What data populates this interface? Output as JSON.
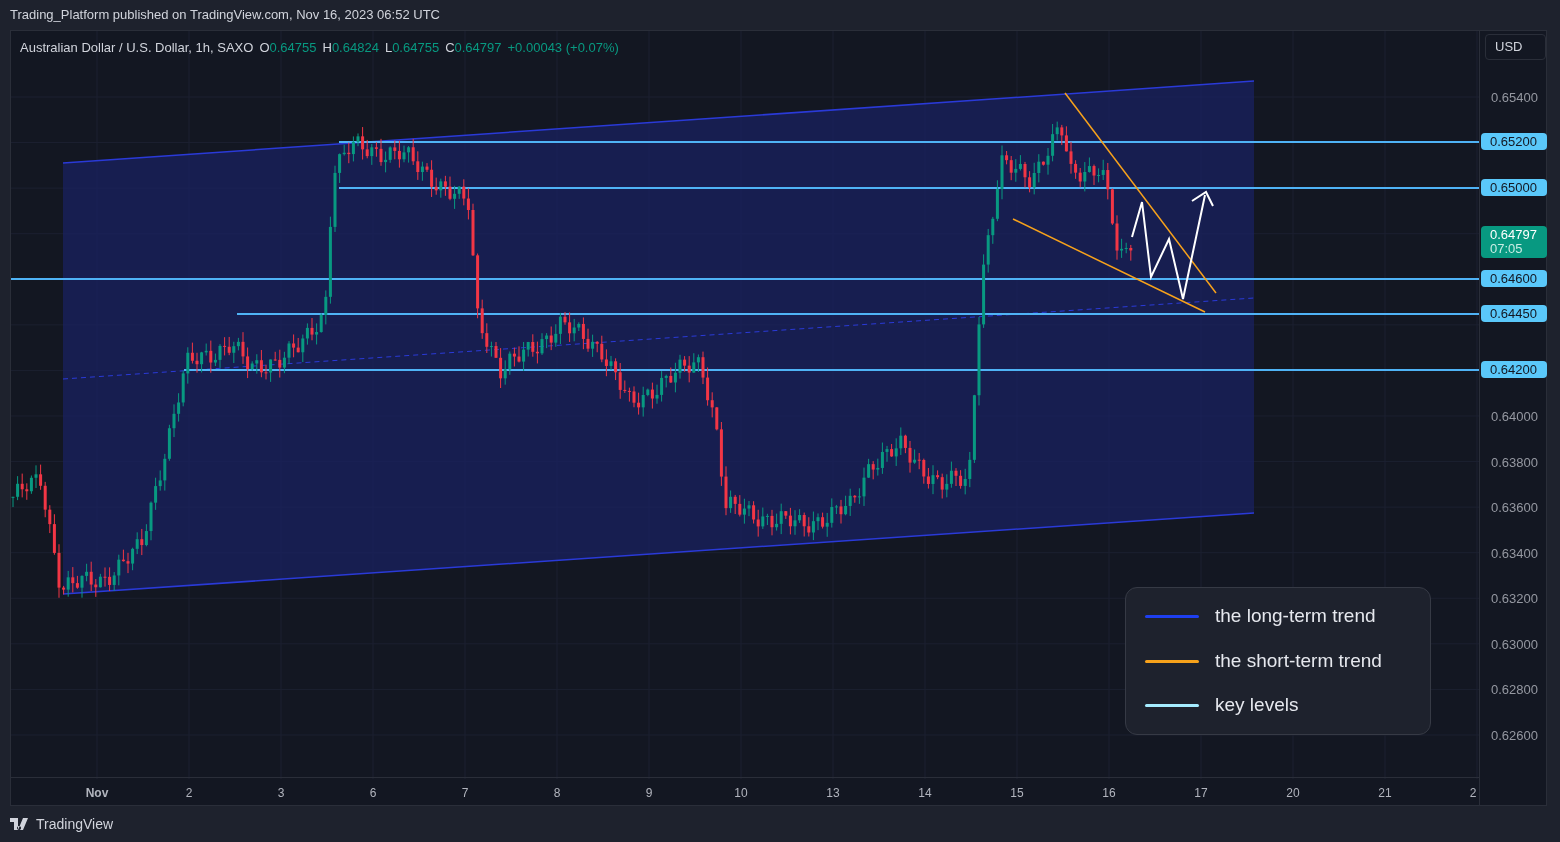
{
  "header": {
    "text": "Trading_Platform published on TradingView.com, Nov 16, 2023 06:52 UTC"
  },
  "symbol_legend": {
    "symbol": "Australian Dollar / U.S. Dollar, 1h, SAXO",
    "values": [
      {
        "label": "O",
        "value": "0.64755"
      },
      {
        "label": "H",
        "value": "0.64824"
      },
      {
        "label": "L",
        "value": "0.64755"
      },
      {
        "label": "C",
        "value": "0.64797"
      }
    ],
    "change": "+0.00043 (+0.07%)"
  },
  "currency": "USD",
  "price_axis": {
    "ticks": [
      "0.65400",
      "0.64000",
      "0.63800",
      "0.63600",
      "0.63400",
      "0.63200",
      "0.63000",
      "0.62800",
      "0.62600"
    ]
  },
  "key_levels": [
    {
      "price": "0.65200"
    },
    {
      "price": "0.65000"
    },
    {
      "price": "0.64600"
    },
    {
      "price": "0.64450"
    },
    {
      "price": "0.64200"
    }
  ],
  "current_price": {
    "price": "0.64797",
    "countdown": "07:05"
  },
  "time_axis": {
    "labels": [
      "Nov",
      "2",
      "3",
      "6",
      "7",
      "8",
      "9",
      "10",
      "13",
      "14",
      "15",
      "16",
      "17",
      "20",
      "21",
      "2"
    ]
  },
  "legend": {
    "items": [
      {
        "label": "the long-term trend",
        "color": "#1e3ff0"
      },
      {
        "label": "the short-term trend",
        "color": "#f7a21b"
      },
      {
        "label": "key levels",
        "color": "#a5ecff"
      }
    ]
  },
  "footer": {
    "brand": "TradingView"
  }
}
